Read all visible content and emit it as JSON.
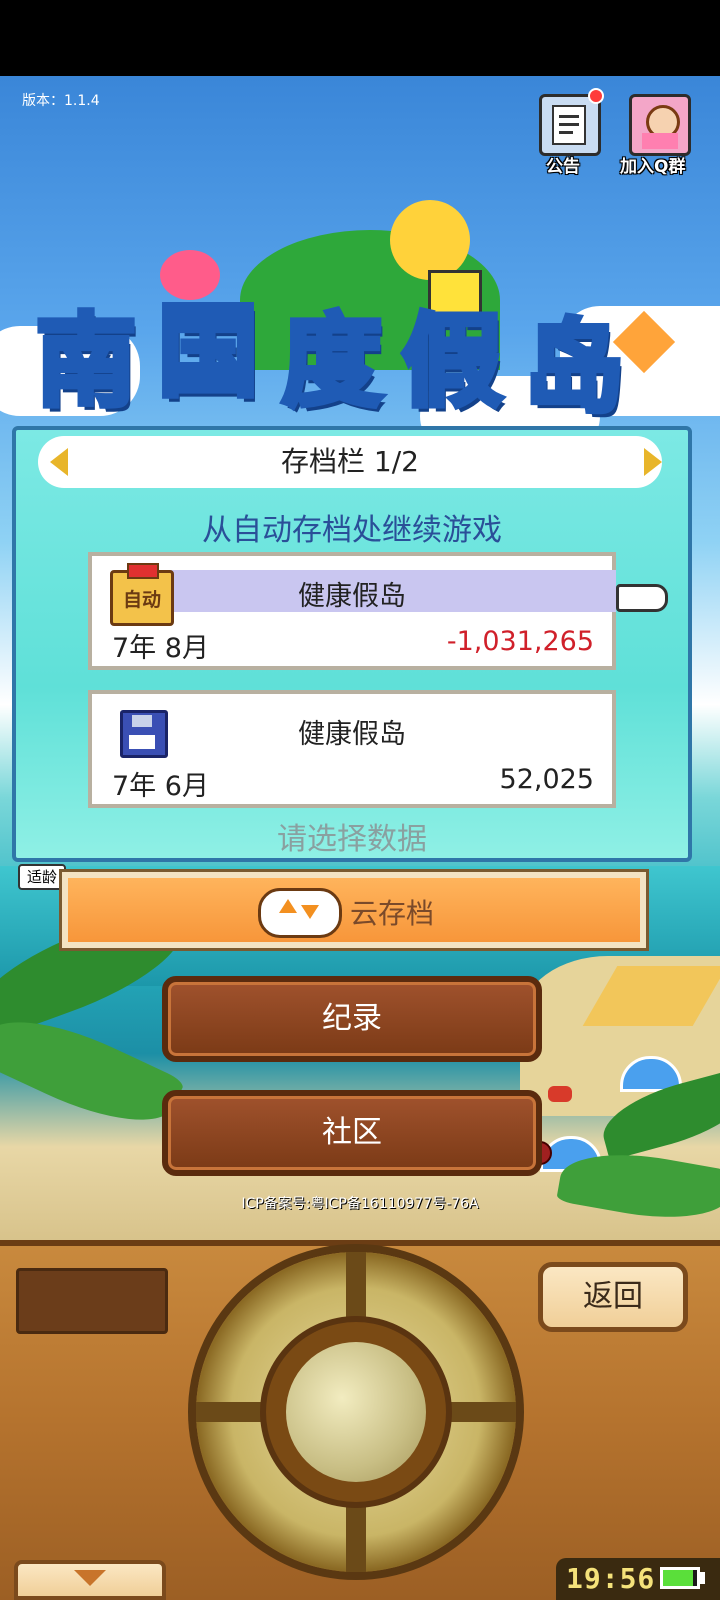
{
  "version_label": "版本：1.1.4",
  "top_icons": {
    "notice_label": "公告",
    "notice_icon": "notice-board-icon",
    "qq_group_label": "加入Q群",
    "qq_group_icon": "girl-avatar-icon"
  },
  "logo": {
    "chars": [
      "南",
      "国",
      "度",
      "假",
      "岛"
    ]
  },
  "save_panel": {
    "title": "存档栏 1/2",
    "continue_text": "从自动存档处继续游戏",
    "slots": [
      {
        "badge": "自动",
        "name": "健康假岛",
        "date": "7年 8月",
        "money": "-1,031,265",
        "money_color": "#d0202a",
        "icon": "auto-save-icon"
      },
      {
        "name": "健康假岛",
        "date": "7年 6月",
        "money": "52,025",
        "money_color": "#222222",
        "icon": "floppy-disk-icon"
      }
    ],
    "select_hint": "请选择数据"
  },
  "rating_tag": "适龄",
  "menu": {
    "cloud_save": "云存档",
    "records": "纪录",
    "community": "社区"
  },
  "icp_text": "ICP备案号:粤ICP备16110977号-76A",
  "controller": {
    "back_label": "返回",
    "clock": "19:56"
  }
}
